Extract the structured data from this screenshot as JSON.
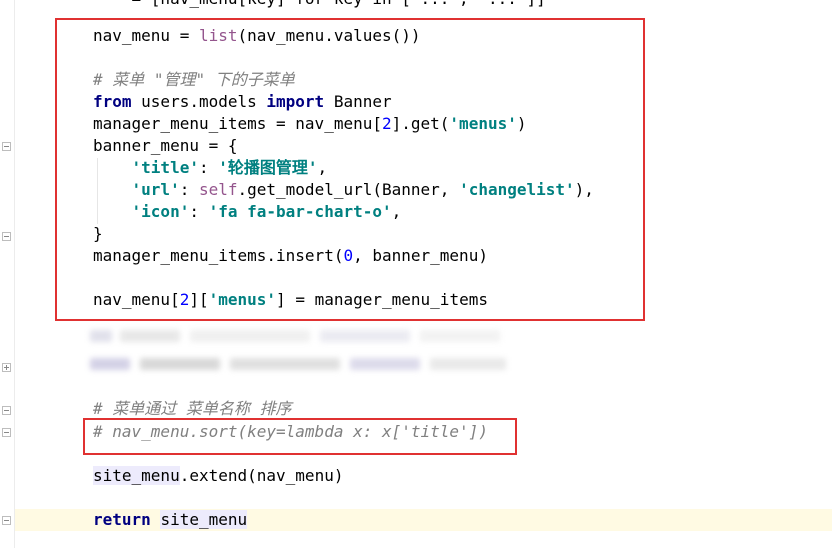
{
  "editor": {
    "top_line": "    = [nav_menu[key] for key in ['...', '...']]",
    "lines": {
      "l1": {
        "a": "nav_menu = ",
        "b": "list",
        "c": "(nav_menu.values())"
      },
      "l2": {
        "comment": "# 菜单 \"管理\" 下的子菜单"
      },
      "l3": {
        "kw1": "from",
        "mid": " users.models ",
        "kw2": "import",
        "tail": " Banner"
      },
      "l4": {
        "a": "manager_menu_items = nav_menu[",
        "num": "2",
        "b": "].get(",
        "str": "'menus'",
        "c": ")"
      },
      "l5": {
        "a": "banner_menu = {"
      },
      "l6": {
        "indent": "    ",
        "key": "'title'",
        "sep": ": ",
        "val": "'轮播图管理'",
        "end": ","
      },
      "l7": {
        "indent": "    ",
        "key": "'url'",
        "sep": ": ",
        "self": "self",
        "mid": ".get_model_url(Banner, ",
        "val": "'changelist'",
        "end": "),"
      },
      "l8": {
        "indent": "    ",
        "key": "'icon'",
        "sep": ": ",
        "val": "'fa fa-bar-chart-o'",
        "end": ","
      },
      "l9": {
        "a": "}"
      },
      "l10": {
        "a": "manager_menu_items.insert(",
        "num": "0",
        "b": ", banner_menu)"
      },
      "l11": {
        "a": "nav_menu[",
        "num": "2",
        "b": "][",
        "str": "'menus'",
        "c": "] = manager_menu_items"
      },
      "l12": {
        "comment": "# 菜单通过 菜单名称 排序"
      },
      "l13": {
        "comment": "# nav_menu.sort(key=lambda x: x['title'])"
      },
      "l14": {
        "hl": "site_menu",
        "b": ".extend(nav_menu)"
      },
      "l15": {
        "kw": "return",
        "sp": " ",
        "hl": "site_menu"
      }
    }
  },
  "colors": {
    "annotation_box": "#e03131",
    "keyword": "#000080",
    "string": "#008080",
    "number": "#0000ff",
    "self": "#94558d",
    "comment": "#808080",
    "caret_line": "#fffae3",
    "usage_highlight": "#edebfc"
  }
}
